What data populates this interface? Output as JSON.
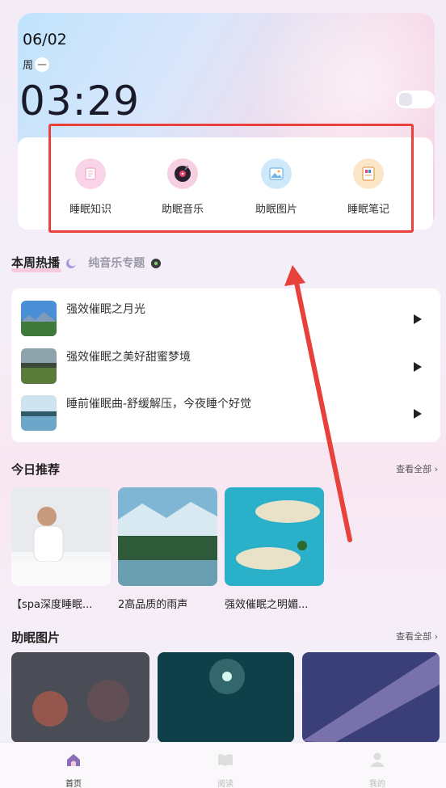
{
  "header": {
    "date": "06/02",
    "weekday_prefix": "周",
    "weekday_badge": "一",
    "time": "03:29"
  },
  "features": [
    {
      "label": "睡眠知识",
      "icon": "notebook-icon",
      "color": "#f9d4e9"
    },
    {
      "label": "助眠音乐",
      "icon": "vinyl-record-icon",
      "color": "#f7cfe3"
    },
    {
      "label": "助眠图片",
      "icon": "picture-icon",
      "color": "#cfe9fb"
    },
    {
      "label": "睡眠笔记",
      "icon": "note-icon",
      "color": "#fbe6c7"
    }
  ],
  "hot": {
    "tab_active": "本周热播",
    "tab_other": "纯音乐专题",
    "items": [
      {
        "title": "强效催眠之月光"
      },
      {
        "title": "强效催眠之美好甜蜜梦境"
      },
      {
        "title": "睡前催眠曲-舒缓解压，今夜睡个好觉"
      }
    ]
  },
  "recommend": {
    "title": "今日推荐",
    "see_all": "查看全部",
    "items": [
      {
        "caption": "【spa深度睡眠..."
      },
      {
        "caption": "2高品质的雨声"
      },
      {
        "caption": "强效催眠之明媚..."
      }
    ]
  },
  "pictures": {
    "title": "助眠图片",
    "see_all": "查看全部"
  },
  "nav": [
    {
      "label": "首页",
      "icon": "home-icon"
    },
    {
      "label": "阅读",
      "icon": "book-icon"
    },
    {
      "label": "我的",
      "icon": "user-icon"
    }
  ],
  "colors": {
    "highlight": "#e8403a",
    "accent_pink": "#f6c9dd"
  }
}
